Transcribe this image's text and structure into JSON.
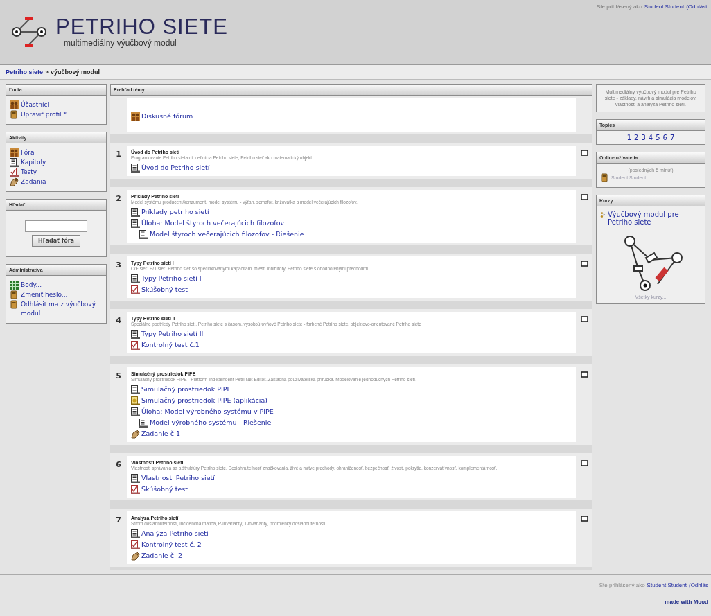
{
  "header": {
    "title": "PETRIHO SIETE",
    "subtitle": "multimediálny výučbový modul",
    "login_text": "Ste prihlásený ako",
    "login_user": "Student Student",
    "login_logout": "(Odhlási"
  },
  "breadcrumb": {
    "home": "Petriho siete",
    "separator": "»",
    "current": "výučbový modul"
  },
  "left_blocks": [
    {
      "kind": "links",
      "title": "Ľudia",
      "items": [
        {
          "label": "Účastníci",
          "kind": "forum"
        },
        {
          "label": "Upraviť profil *",
          "kind": "user"
        }
      ]
    },
    {
      "kind": "links",
      "title": "Aktivity",
      "items": [
        {
          "label": "Fóra",
          "kind": "forum"
        },
        {
          "label": "Kapitoly",
          "kind": "page"
        },
        {
          "label": "Testy",
          "kind": "quiz"
        },
        {
          "label": "Zadania",
          "kind": "assignment"
        }
      ]
    },
    {
      "kind": "search",
      "title": "Hľadať",
      "button": "Hľadať fóra"
    },
    {
      "kind": "links",
      "title": "Administratíva",
      "items": [
        {
          "label": "Body...",
          "kind": "grades"
        },
        {
          "label": "Zmeniť heslo...",
          "kind": "user"
        },
        {
          "label": "Odhlásiť ma z výučbový modul...",
          "kind": "user"
        }
      ]
    }
  ],
  "center": {
    "title": "Prehľad témy",
    "intro": {
      "items": [
        {
          "label": "Diskusné fórum",
          "kind": "forum"
        }
      ]
    },
    "sections": [
      {
        "number": "1",
        "title": "Úvod do Petriho sietí",
        "description": "Programovanie Petriho sietami, definícia Petriho siete, Petriho sieť ako matematický objekt.",
        "items": [
          {
            "label": "Úvod do Petriho sietí",
            "kind": "page"
          }
        ]
      },
      {
        "number": "2",
        "title": "Príklady Petriho sietí",
        "description": "Model systému producent/konzument, model systému - výťah, semafór, križovatka a model večerajúcich filozofov.",
        "items": [
          {
            "label": "Príklady petriho sietí",
            "kind": "page"
          },
          {
            "label": "Úloha: Model štyroch večerajúcich filozofov",
            "kind": "page",
            "children": [
              {
                "label": "Model štyroch večerajúcich filozofov - Riešenie",
                "kind": "page"
              }
            ]
          }
        ]
      },
      {
        "number": "3",
        "title": "Typy Petriho sietí I",
        "description": "C/E sieť, P/T sieť, Petriho sieť so špecifikovanými kapacitami miest, inhibítory, Petriho siete s ohodnotenými prechodmi.",
        "items": [
          {
            "label": "Typy Petriho sietí I",
            "kind": "page"
          },
          {
            "label": "Skúšobný test",
            "kind": "quiz"
          }
        ]
      },
      {
        "number": "4",
        "title": "Typy Petriho sietí II",
        "description": "Špeciálne podtriedy Petriho sietí, Petriho siete s časom, vysokoúrovňové Petriho siete - farbené Petriho siete, objektovo-orientované Petriho siete",
        "items": [
          {
            "label": "Typy Petriho sietí II",
            "kind": "page"
          },
          {
            "label": "Kontrolný test č.1",
            "kind": "quiz"
          }
        ]
      },
      {
        "number": "5",
        "title": "Simulačný prostriedok PIPE",
        "description": "Simulačný prostriedok PIPE - Platform Independent Petri Net Editor. Základná používateľská príručka. Modelovanie jednoduchých Petriho sietí.",
        "items": [
          {
            "label": "Simulačný prostriedok PIPE",
            "kind": "page"
          },
          {
            "label": "Simulačný prostriedok PIPE (aplikácia)",
            "kind": "applet"
          },
          {
            "label": "Úloha: Model výrobného systému v PIPE",
            "kind": "page",
            "children": [
              {
                "label": "Model výrobného systému - Riešenie",
                "kind": "page"
              }
            ]
          },
          {
            "label": "Zadanie č.1",
            "kind": "assignment"
          }
        ]
      },
      {
        "number": "6",
        "title": "Vlastnosti Petriho sietí",
        "description": "Vlastnosti správania sa a štruktúry Petriho siete. Dosiahnuteľnosť značkovania, živé a mŕtve prechody, ohraničenosť, bezpečnosť, živosť, pokrytie, konzervatívnosť, komplementárnosť.",
        "items": [
          {
            "label": "Vlastnosti Petriho sietí",
            "kind": "page"
          },
          {
            "label": "Skúšobný test",
            "kind": "quiz"
          }
        ]
      },
      {
        "number": "7",
        "title": "Analýza Petriho sietí",
        "description": "Strom dosiahnuteľnosti, incidenčná matica, P-invarianty, T-invarianty, podmienky dosiahnuteľnosti.",
        "items": [
          {
            "label": "Analýza Petriho sietí",
            "kind": "page"
          },
          {
            "label": "Kontrolný test č. 2",
            "kind": "quiz"
          },
          {
            "label": "Zadanie č. 2",
            "kind": "assignment"
          }
        ]
      }
    ]
  },
  "right_blocks": [
    {
      "kind": "text",
      "text": "Multimediálny výučbový modul pre Petriho siete - základy, návrh a simulácia modelov, vlastnosti a analýza Petriho sietí."
    },
    {
      "kind": "topics",
      "title": "Topics",
      "links": [
        "1",
        "2",
        "3",
        "4",
        "5",
        "6",
        "7"
      ]
    },
    {
      "kind": "users",
      "title": "Online užívatelia",
      "note": "(posledných 5 minút)",
      "users": [
        "Student Student"
      ]
    },
    {
      "kind": "courses",
      "title": "Kurzy",
      "course": "Výučbový modul pre Petriho siete",
      "more": "Všetky kurzy..."
    }
  ],
  "footer": {
    "login_text": "Ste prihlásený ako",
    "login_user": "Student Student",
    "login_logout": "(Odhlás",
    "credit": "made with Mood"
  }
}
